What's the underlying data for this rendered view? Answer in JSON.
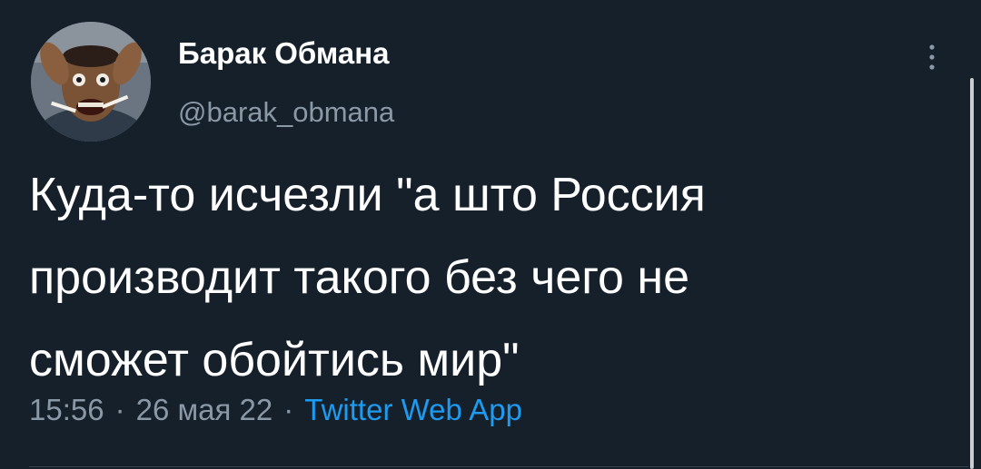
{
  "tweet": {
    "author": {
      "display_name": "Барак Обмана",
      "handle": "@barak_obmana",
      "avatar_icon": "avatar-photo-icon"
    },
    "text_lines": [
      "Куда-то исчезли \"а што Россия",
      "производит такого без чего не",
      "сможет обойтись мир\""
    ],
    "time": "15:56",
    "date": "26 мая 22",
    "separator": "·",
    "source": "Twitter Web App",
    "more_icon": "more-vertical-icon"
  },
  "colors": {
    "background": "#15202b",
    "primary_text": "#ffffff",
    "secondary_text": "#8b98a5",
    "accent": "#1d9bf0"
  }
}
